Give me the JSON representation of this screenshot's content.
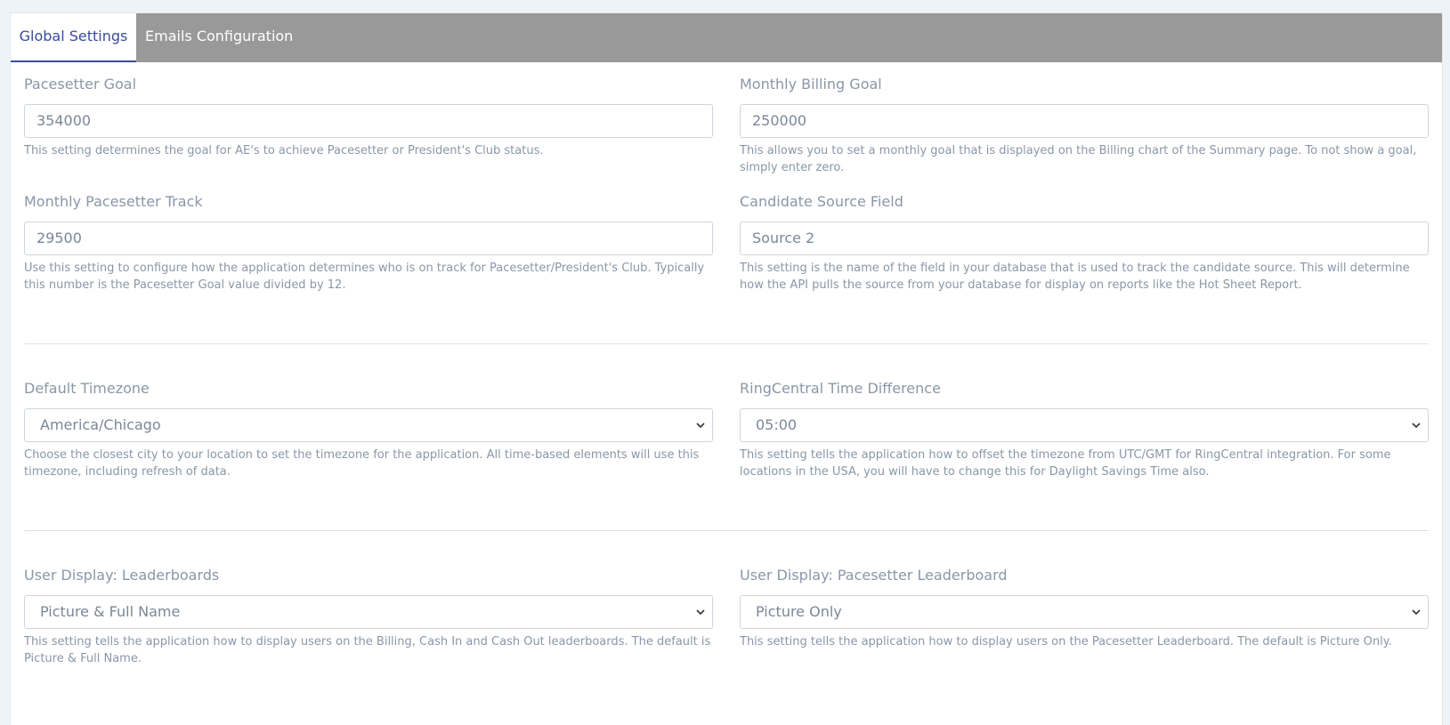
{
  "tabs": {
    "global": "Global Settings",
    "emails": "Emails Configuration"
  },
  "settings": {
    "pacesetter_goal": {
      "label": "Pacesetter Goal",
      "value": "354000",
      "help": "This setting determines the goal for AE's to achieve Pacesetter or President's Club status."
    },
    "monthly_billing_goal": {
      "label": "Monthly Billing Goal",
      "value": "250000",
      "help": "This allows you to set a monthly goal that is displayed on the Billing chart of the Summary page. To not show a goal, simply enter zero."
    },
    "monthly_pacesetter_track": {
      "label": "Monthly Pacesetter Track",
      "value": "29500",
      "help": "Use this setting to configure how the application determines who is on track for Pacesetter/President's Club. Typically this number is the Pacesetter Goal value divided by 12."
    },
    "candidate_source_field": {
      "label": "Candidate Source Field",
      "value": "Source 2",
      "help": "This setting is the name of the field in your database that is used to track the candidate source. This will determine how the API pulls the source from your database for display on reports like the Hot Sheet Report."
    },
    "default_timezone": {
      "label": "Default Timezone",
      "value": "America/Chicago",
      "help": "Choose the closest city to your location to set the timezone for the application. All time-based elements will use this timezone, including refresh of data."
    },
    "ringcentral_time_difference": {
      "label": "RingCentral Time Difference",
      "value": "05:00",
      "help": "This setting tells the application how to offset the timezone from UTC/GMT for RingCentral integration. For some locations in the USA, you will have to change this for Daylight Savings Time also."
    },
    "user_display_leaderboards": {
      "label": "User Display: Leaderboards",
      "value": "Picture & Full Name",
      "help": "This setting tells the application how to display users on the Billing, Cash In and Cash Out leaderboards. The default is Picture & Full Name."
    },
    "user_display_pacesetter_leaderboard": {
      "label": "User Display: Pacesetter Leaderboard",
      "value": "Picture Only",
      "help": "This setting tells the application how to display users on the Pacesetter Leaderboard. The default is Picture Only."
    }
  },
  "icons": {
    "select_arrow": "chevron-down-icon"
  },
  "colors": {
    "tab_bar": "#999999",
    "active_tab_text": "#3a4b9a",
    "label_text": "#8a97a8",
    "input_border": "#cfd6de"
  }
}
